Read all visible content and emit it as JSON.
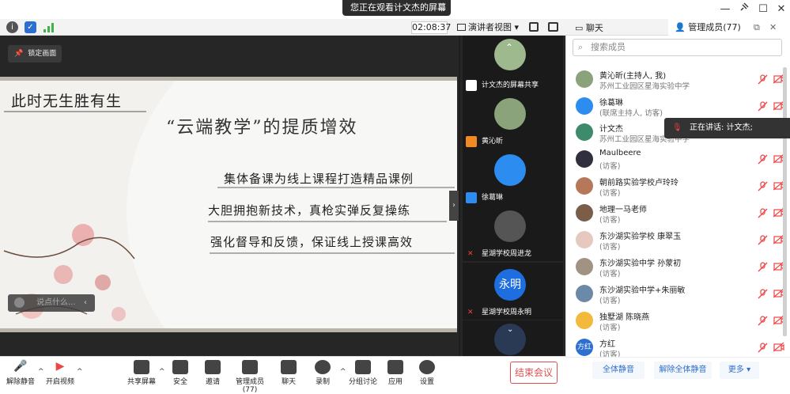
{
  "titlebar": {
    "viewing": "您正在观看计文杰的屏幕"
  },
  "topstrip": {
    "timer": "02:08:37",
    "view_mode": "演讲者视图"
  },
  "stage": {
    "lock_label": "锁定画面",
    "chat_placeholder": "说点什么...",
    "slide": {
      "heading": "此时无生胜有生",
      "title": "“云端教学”的提质增效",
      "lines": [
        "集体备课为线上课程打造精品课例",
        "大胆拥抱新技术，真枪实弹反复操练",
        "强化督导和反馈，保证线上授课高效"
      ]
    }
  },
  "tiles": [
    {
      "name": "计文杰的屏幕共享"
    },
    {
      "name": "黄沁昕"
    },
    {
      "name": "徐葛琳"
    },
    {
      "name": "星湖学校周进龙"
    },
    {
      "name": "星湖学校周永明",
      "avatar_text": "永明"
    },
    {
      "name": ""
    }
  ],
  "toolbar": {
    "unmute": "解除静音",
    "start_video": "开启视频",
    "share": "共享屏幕",
    "security": "安全",
    "invite": "邀请",
    "members": "管理成员(77)",
    "chat": "聊天",
    "record": "录制",
    "breakout": "分组讨论",
    "apps": "应用",
    "settings": "设置",
    "end": "结束会议"
  },
  "right": {
    "tab_chat": "聊天",
    "tab_members": "管理成员(77)",
    "search_placeholder": "搜索成员",
    "speaking": "正在讲话: 计文杰;",
    "members": [
      {
        "name": "黄沁昕(主持人, 我)",
        "sub": "苏州工业园区星海实验中学",
        "avatar_color": "#8aa37a"
      },
      {
        "name": "徐葛琳",
        "sub": "(联席主持人, 访客)",
        "avatar_color": "#2d8cf0"
      },
      {
        "name": "计文杰",
        "sub": "苏州工业园区星海实验中学",
        "avatar_color": "#3d8b6b"
      },
      {
        "name": "Maulbeere",
        "sub": "(访客)",
        "avatar_color": "#2f2f3f"
      },
      {
        "name": "朝前路实验学校卢玲玲",
        "sub": "(访客)",
        "avatar_color": "#b5785a"
      },
      {
        "name": "地理一马老师",
        "sub": "(访客)",
        "avatar_color": "#7b5e4a"
      },
      {
        "name": "东沙湖实验学校 康翠玉",
        "sub": "(访客)",
        "avatar_color": "#e6c8bf"
      },
      {
        "name": "东沙湖实验中学 孙蒙初",
        "sub": "(访客)",
        "avatar_color": "#a19384"
      },
      {
        "name": "东沙湖实验中学+朱丽敏",
        "sub": "(访客)",
        "avatar_color": "#6c8aa8"
      },
      {
        "name": "独墅湖 陈晓燕",
        "sub": "(访客)",
        "avatar_color": "#f2b93b"
      },
      {
        "name": "方红",
        "sub": "(访客)",
        "avatar_color": "#2d6fd0",
        "avatar_text": "方红"
      }
    ],
    "mute_all": "全体静音",
    "unmute_all": "解除全体静音",
    "more": "更多 ▾"
  }
}
